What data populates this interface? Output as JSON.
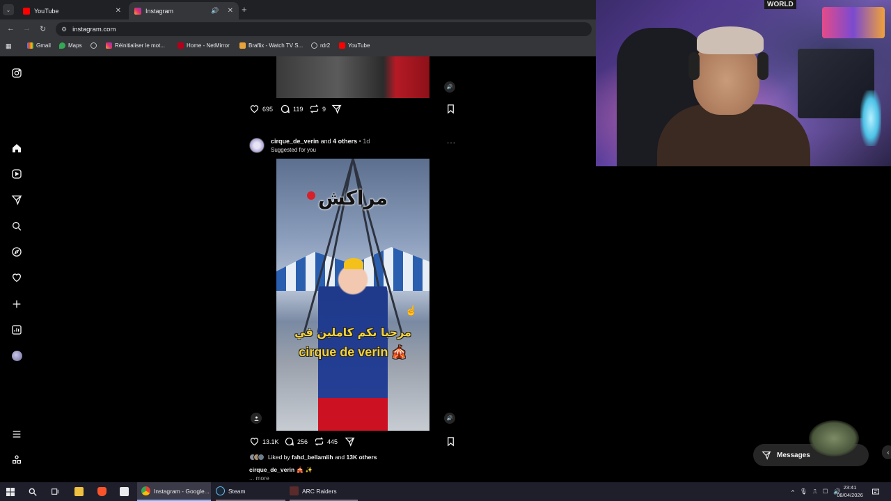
{
  "browser": {
    "tabs": [
      {
        "label": "YouTube",
        "active": false
      },
      {
        "label": "Instagram",
        "active": true
      }
    ],
    "new_tab": "+",
    "address": "instagram.com",
    "bookmarks": [
      "Gmail",
      "Maps",
      "Réinitialiser le mot...",
      "Home - NetMirror",
      "Braflix - Watch TV S...",
      "rdr2",
      "YouTube"
    ]
  },
  "post_top": {
    "likes": "695",
    "comments": "119",
    "reposts": "9"
  },
  "post_main": {
    "username": "cirque_de_verin",
    "and_text": "and",
    "others": "4 others",
    "time": "1d",
    "suggested": "Suggested for you",
    "menu": "···",
    "overlay_title": "مراكش",
    "overlay_caption_ar": "مرحبا بكم كاملين في",
    "overlay_caption_en": "cirque de verin 🎪",
    "likes": "13.1K",
    "comments": "256",
    "reposts": "445",
    "liked_by_prefix": "Liked by",
    "liked_by_user": "fahd_bellamlih",
    "liked_by_and": "and",
    "liked_by_count": "13K others",
    "caption_user": "cirque_de_verin",
    "caption_text": "🎪 ✨",
    "more": "... more"
  },
  "messages_button": "Messages",
  "taskbar": {
    "apps": [
      {
        "label": "Instagram - Google..."
      },
      {
        "label": "Steam"
      },
      {
        "label": "ARC Raiders"
      }
    ],
    "time": "23:41",
    "date": "08/04/2026"
  },
  "webcam": {
    "sign_text": "WORLD"
  },
  "colors": {
    "chrome_bg": "#35363a",
    "tabbar_bg": "#202124",
    "ig_bg": "#000000",
    "taskbar_bg": "#1f1f2b",
    "overlay_yellow": "#f3d23b"
  }
}
